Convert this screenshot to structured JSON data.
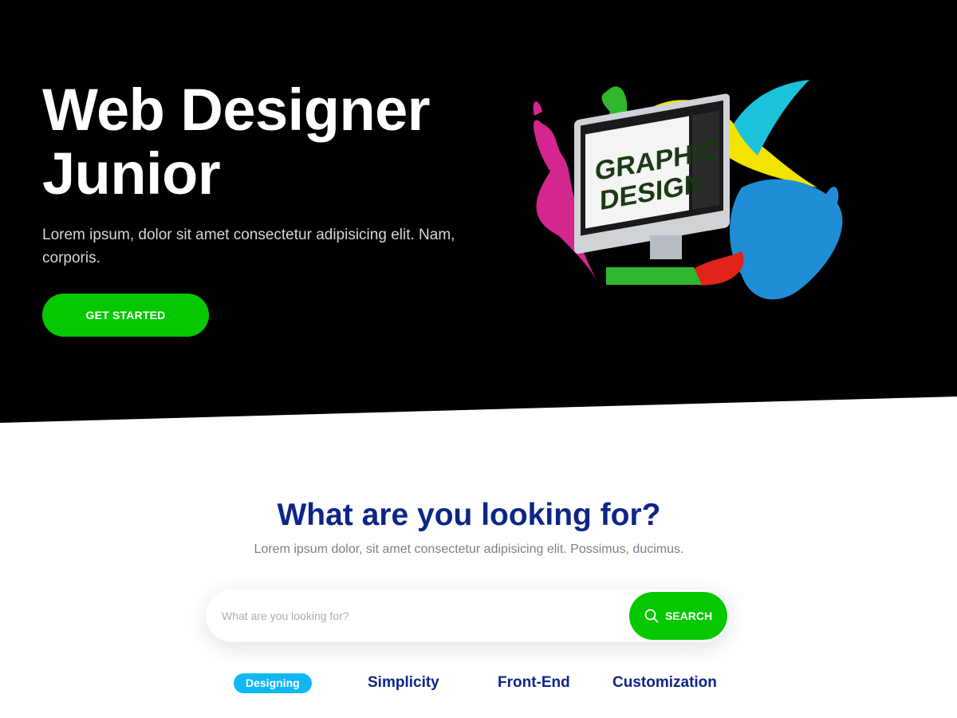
{
  "hero": {
    "title_line1": "Web Designer",
    "title_line2": "Junior",
    "subtitle": "Lorem ipsum, dolor sit amet consectetur adipisicing elit. Nam, corporis.",
    "cta_label": "GET STARTED"
  },
  "illustration": {
    "screen_text_line1": "GRAPHIC",
    "screen_text_line2": "DESIGN"
  },
  "search_section": {
    "title": "What are you looking for?",
    "subtitle": "Lorem ipsum dolor, sit amet consectetur adipisicing elit. Possimus, ducimus.",
    "input_placeholder": "What are you looking for?",
    "input_value": "",
    "button_label": "SEARCH",
    "button_icon": "search-icon"
  },
  "tags": [
    {
      "label": "Designing",
      "active": true
    },
    {
      "label": "Simplicity",
      "active": false
    },
    {
      "label": "Front-End",
      "active": false
    },
    {
      "label": "Customization",
      "active": false
    }
  ],
  "colors": {
    "hero_background": "#000000",
    "accent_green": "#06c800",
    "heading_blue": "#0c2687",
    "tag_active": "#11b7f3"
  }
}
